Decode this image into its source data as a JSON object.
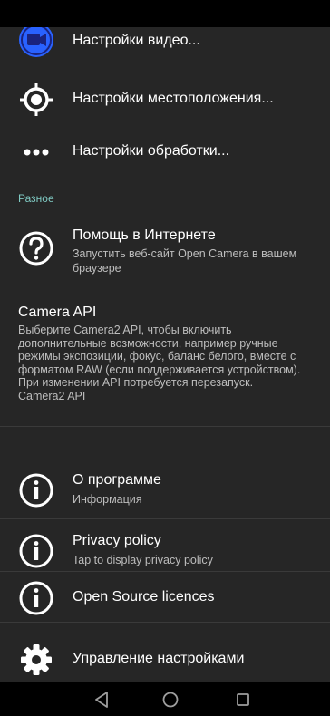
{
  "settings": {
    "video": {
      "title": "Настройки видео...",
      "icon": "video-camera-icon"
    },
    "location": {
      "title": "Настройки местоположения...",
      "icon": "location-target-icon"
    },
    "processing": {
      "title": "Настройки обработки...",
      "icon": "more-dots-icon"
    },
    "misc_header": "Разное",
    "online_help": {
      "title": "Помощь в Интернете",
      "summary": "Запустить веб-сайт Open Camera в вашем браузере",
      "icon": "help-circle-icon"
    },
    "camera_api": {
      "title": "Camera API",
      "summary": "Выберите Camera2 API, чтобы включить дополнительные возможности, например ручные режимы экспозиции, фокус, баланс белого, вместе с форматом RAW (если поддерживается устройством). При изменении API потребуется перезапуск.",
      "value": "Camera2 API"
    },
    "about": {
      "title": "О программе",
      "summary": "Информация",
      "icon": "info-circle-icon"
    },
    "privacy": {
      "title": "Privacy policy",
      "summary": "Tap to display privacy policy",
      "icon": "info-circle-icon"
    },
    "licences": {
      "title": "Open Source licences",
      "icon": "info-circle-icon"
    },
    "manage": {
      "title": "Управление настройками",
      "icon": "gear-icon"
    }
  },
  "navbar": {
    "back": "back-triangle-icon",
    "home": "home-circle-icon",
    "recents": "recents-square-icon"
  },
  "colors": {
    "background": "#262626",
    "accent": "#80cbc4",
    "video_icon": "#2962ff"
  }
}
